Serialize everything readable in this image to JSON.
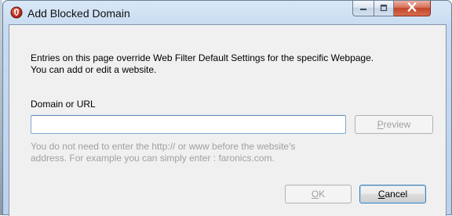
{
  "window": {
    "title": "Add Blocked Domain",
    "app_icon": "faronics-shield-icon"
  },
  "title_buttons": {
    "minimize_icon": "minimize-icon",
    "maximize_icon": "maximize-icon",
    "close_icon": "close-icon"
  },
  "dialog": {
    "info_line1": "Entries on this page override Web Filter Default Settings for the specific Webpage.",
    "info_line2": "You can add or edit a website.",
    "field_label": "Domain or URL",
    "url_value": "",
    "url_placeholder": "",
    "preview_label": "Preview",
    "hint_line1": "You do not need to enter the http:// or www before the website's",
    "hint_line2": "address. For example you can simply enter : faronics.com.",
    "ok_label": "OK",
    "cancel_label": "Cancel"
  },
  "colors": {
    "titlebar": "#c7dbf0",
    "client_bg": "#f0f0f0",
    "close_button": "#c2462b",
    "hint_text": "#a0a0a0",
    "input_border": "#7ea7cf"
  }
}
